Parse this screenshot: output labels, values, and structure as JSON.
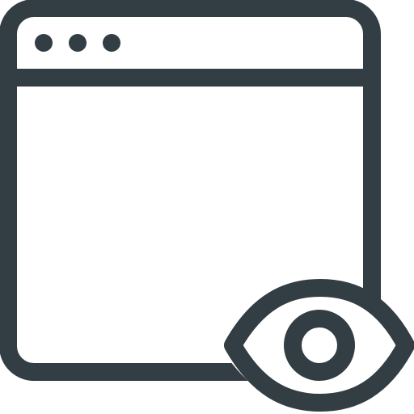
{
  "icon": {
    "name": "browser-window-view-icon",
    "stroke_color": "#323d44",
    "fill_color": "#ffffff",
    "parts": [
      "window-frame",
      "title-bar-divider",
      "window-dots",
      "eye-outline",
      "eye-pupil"
    ]
  }
}
